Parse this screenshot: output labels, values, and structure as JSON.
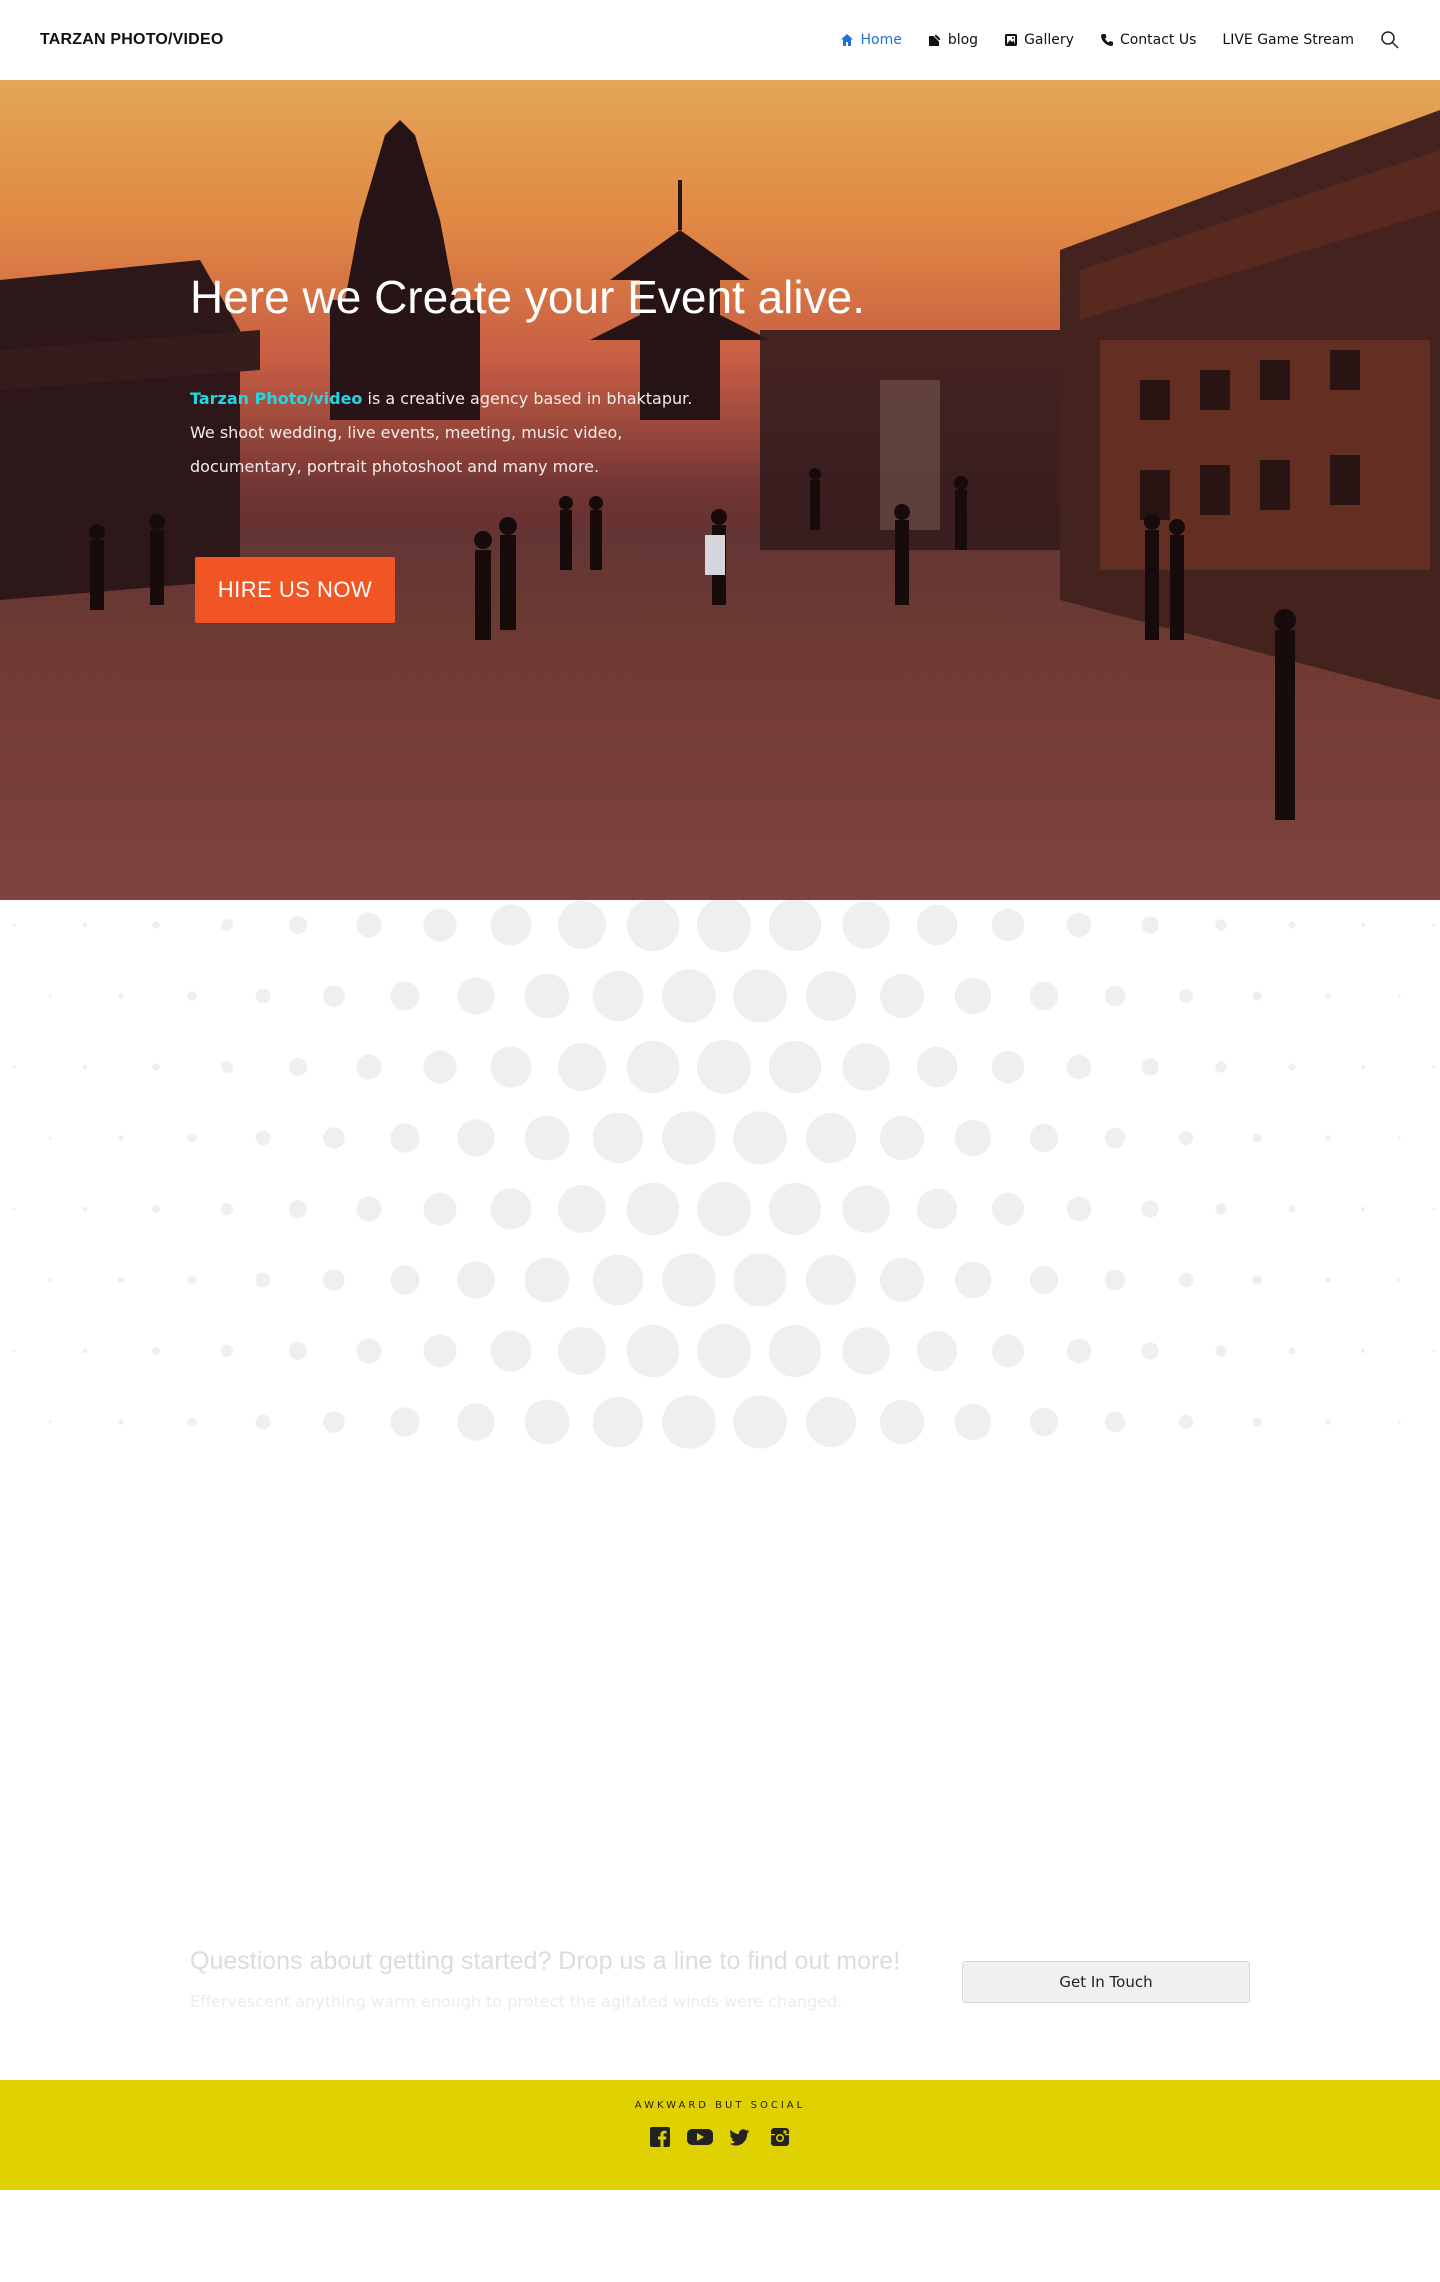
{
  "header": {
    "site_title": "TARZAN PHOTO/VIDEO",
    "nav": [
      {
        "label": "Home",
        "icon": "home-icon",
        "active": true
      },
      {
        "label": "blog",
        "icon": "edit-icon"
      },
      {
        "label": "Gallery",
        "icon": "image-icon"
      },
      {
        "label": "Contact Us",
        "icon": "phone-icon"
      },
      {
        "label": "LIVE Game Stream",
        "icon": ""
      }
    ],
    "search_icon": "search-icon",
    "active_color": "#1f73d4"
  },
  "hero": {
    "title": "Here we Create your Event alive.",
    "brand": "Tarzan Photo/video",
    "line1": " is a creative agency based in bhaktapur.",
    "line2": "We shoot wedding, live events, meeting, music video,",
    "line3": "documentary, portrait photoshoot and many more.",
    "button": "HIRE US NOW",
    "button_color": "#f05523",
    "brand_color": "#22d6e6"
  },
  "cta": {
    "heading": "Questions about getting started? Drop us a line to find out more!",
    "subtext": "Effervescent anything warm enough to protect the agitated winds were changed.",
    "button": "Get In Touch"
  },
  "footer": {
    "label": "AWKWARD BUT SOCIAL",
    "background": "#dfd100",
    "social": [
      "facebook-icon",
      "youtube-icon",
      "twitter-icon",
      "instagram-icon"
    ]
  }
}
